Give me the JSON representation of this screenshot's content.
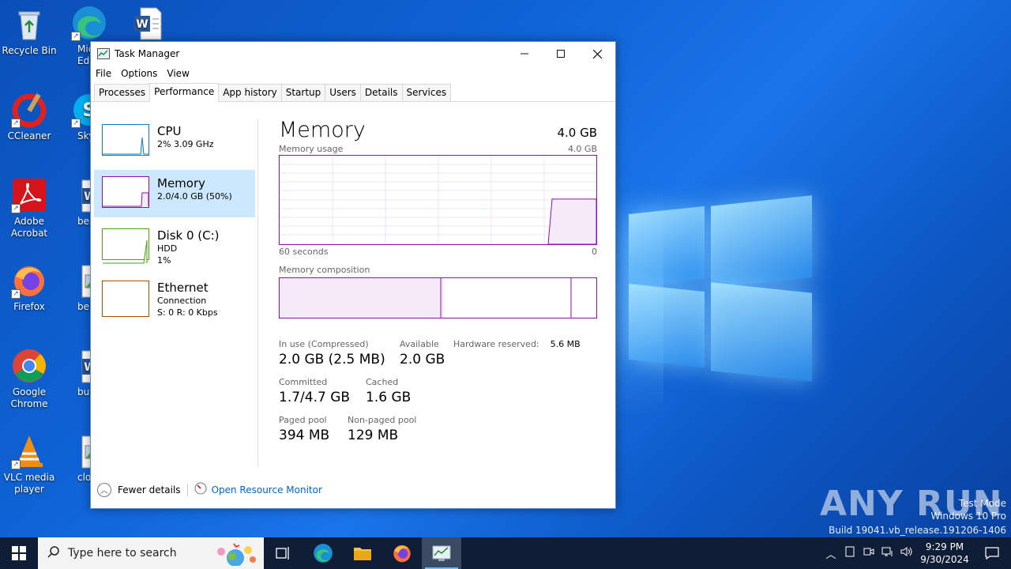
{
  "desktop": {
    "icons": [
      {
        "label": "Recycle Bin",
        "icon": "recycle-bin-icon"
      },
      {
        "label": "Micro Ed",
        "icon": "edge-icon"
      },
      {
        "label": "",
        "icon": "word-doc-icon"
      },
      {
        "label": "CCleaner",
        "icon": "ccleaner-icon"
      },
      {
        "label": "Sky",
        "icon": "skype-icon"
      },
      {
        "label": "Adobe Acrobat",
        "icon": "acrobat-icon"
      },
      {
        "label": "beauti",
        "icon": "word-doc-icon"
      },
      {
        "label": "Firefox",
        "icon": "firefox-icon"
      },
      {
        "label": "believe",
        "icon": "image-file-icon"
      },
      {
        "label": "Google Chrome",
        "icon": "chrome-icon"
      },
      {
        "label": "button",
        "icon": "word-doc-icon"
      },
      {
        "label": "VLC media player",
        "icon": "vlc-icon"
      },
      {
        "label": "clothi",
        "icon": "image-file-icon"
      }
    ],
    "watermark": {
      "brand": "ANY RUN",
      "line1": "Test Mode",
      "line2": "Windows 10 Pro",
      "line3": "Build 19041.vb_release.191206-1406"
    }
  },
  "window": {
    "title": "Task Manager",
    "menu": [
      "File",
      "Options",
      "View"
    ],
    "tabs": [
      "Processes",
      "Performance",
      "App history",
      "Startup",
      "Users",
      "Details",
      "Services"
    ],
    "active_tab": "Performance"
  },
  "sidebar": {
    "items": [
      {
        "name": "CPU",
        "sub1": "2% 3.09 GHz",
        "sub2": "",
        "color": "#117dbb"
      },
      {
        "name": "Memory",
        "sub1": "2.0/4.0 GB (50%)",
        "sub2": "",
        "color": "#8b12ae"
      },
      {
        "name": "Disk 0 (C:)",
        "sub1": "HDD",
        "sub2": "1%",
        "color": "#4da60c"
      },
      {
        "name": "Ethernet",
        "sub1": "Connection",
        "sub2": "S: 0 R: 0 Kbps",
        "color": "#a74f01"
      }
    ]
  },
  "memory": {
    "title": "Memory",
    "total": "4.0 GB",
    "usage_label": "Memory usage",
    "usage_max": "4.0 GB",
    "time_left": "60 seconds",
    "time_right": "0",
    "composition_label": "Memory composition",
    "usage_fraction": 0.5,
    "stats": {
      "in_use_label": "In use (Compressed)",
      "in_use_value": "2.0 GB (2.5 MB)",
      "available_label": "Available",
      "available_value": "2.0 GB",
      "hw_reserved_label": "Hardware reserved:",
      "hw_reserved_value": "5.6 MB",
      "committed_label": "Committed",
      "committed_value": "1.7/4.7 GB",
      "cached_label": "Cached",
      "cached_value": "1.6 GB",
      "paged_label": "Paged pool",
      "paged_value": "394 MB",
      "nonpaged_label": "Non-paged pool",
      "nonpaged_value": "129 MB"
    }
  },
  "footer": {
    "fewer_details": "Fewer details",
    "open_monitor": "Open Resource Monitor"
  },
  "taskbar": {
    "search_placeholder": "Type here to search",
    "time": "9:29 PM",
    "date": "9/30/2024"
  }
}
